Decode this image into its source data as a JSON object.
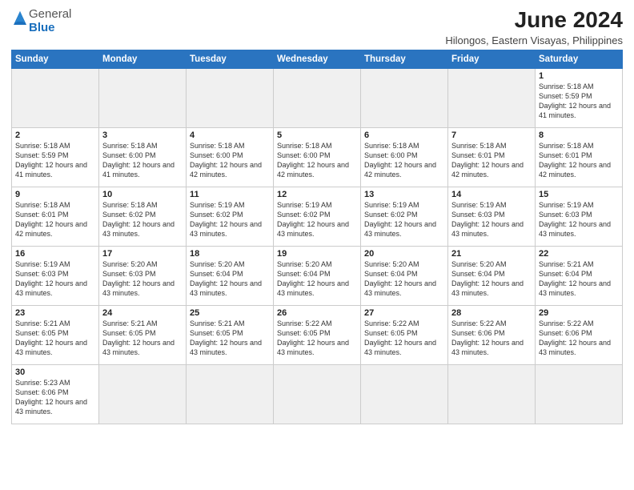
{
  "header": {
    "logo_general": "General",
    "logo_blue": "Blue",
    "title": "June 2024",
    "subtitle": "Hilongos, Eastern Visayas, Philippines"
  },
  "weekdays": [
    "Sunday",
    "Monday",
    "Tuesday",
    "Wednesday",
    "Thursday",
    "Friday",
    "Saturday"
  ],
  "weeks": [
    [
      {
        "day": "",
        "info": "",
        "empty": true
      },
      {
        "day": "",
        "info": "",
        "empty": true
      },
      {
        "day": "",
        "info": "",
        "empty": true
      },
      {
        "day": "",
        "info": "",
        "empty": true
      },
      {
        "day": "",
        "info": "",
        "empty": true
      },
      {
        "day": "",
        "info": "",
        "empty": true
      },
      {
        "day": "1",
        "info": "Sunrise: 5:18 AM\nSunset: 5:59 PM\nDaylight: 12 hours and 41 minutes.",
        "empty": false
      }
    ],
    [
      {
        "day": "2",
        "info": "Sunrise: 5:18 AM\nSunset: 5:59 PM\nDaylight: 12 hours and 41 minutes.",
        "empty": false
      },
      {
        "day": "3",
        "info": "Sunrise: 5:18 AM\nSunset: 6:00 PM\nDaylight: 12 hours and 41 minutes.",
        "empty": false
      },
      {
        "day": "4",
        "info": "Sunrise: 5:18 AM\nSunset: 6:00 PM\nDaylight: 12 hours and 42 minutes.",
        "empty": false
      },
      {
        "day": "5",
        "info": "Sunrise: 5:18 AM\nSunset: 6:00 PM\nDaylight: 12 hours and 42 minutes.",
        "empty": false
      },
      {
        "day": "6",
        "info": "Sunrise: 5:18 AM\nSunset: 6:00 PM\nDaylight: 12 hours and 42 minutes.",
        "empty": false
      },
      {
        "day": "7",
        "info": "Sunrise: 5:18 AM\nSunset: 6:01 PM\nDaylight: 12 hours and 42 minutes.",
        "empty": false
      },
      {
        "day": "8",
        "info": "Sunrise: 5:18 AM\nSunset: 6:01 PM\nDaylight: 12 hours and 42 minutes.",
        "empty": false
      }
    ],
    [
      {
        "day": "9",
        "info": "Sunrise: 5:18 AM\nSunset: 6:01 PM\nDaylight: 12 hours and 42 minutes.",
        "empty": false
      },
      {
        "day": "10",
        "info": "Sunrise: 5:18 AM\nSunset: 6:02 PM\nDaylight: 12 hours and 43 minutes.",
        "empty": false
      },
      {
        "day": "11",
        "info": "Sunrise: 5:19 AM\nSunset: 6:02 PM\nDaylight: 12 hours and 43 minutes.",
        "empty": false
      },
      {
        "day": "12",
        "info": "Sunrise: 5:19 AM\nSunset: 6:02 PM\nDaylight: 12 hours and 43 minutes.",
        "empty": false
      },
      {
        "day": "13",
        "info": "Sunrise: 5:19 AM\nSunset: 6:02 PM\nDaylight: 12 hours and 43 minutes.",
        "empty": false
      },
      {
        "day": "14",
        "info": "Sunrise: 5:19 AM\nSunset: 6:03 PM\nDaylight: 12 hours and 43 minutes.",
        "empty": false
      },
      {
        "day": "15",
        "info": "Sunrise: 5:19 AM\nSunset: 6:03 PM\nDaylight: 12 hours and 43 minutes.",
        "empty": false
      }
    ],
    [
      {
        "day": "16",
        "info": "Sunrise: 5:19 AM\nSunset: 6:03 PM\nDaylight: 12 hours and 43 minutes.",
        "empty": false
      },
      {
        "day": "17",
        "info": "Sunrise: 5:20 AM\nSunset: 6:03 PM\nDaylight: 12 hours and 43 minutes.",
        "empty": false
      },
      {
        "day": "18",
        "info": "Sunrise: 5:20 AM\nSunset: 6:04 PM\nDaylight: 12 hours and 43 minutes.",
        "empty": false
      },
      {
        "day": "19",
        "info": "Sunrise: 5:20 AM\nSunset: 6:04 PM\nDaylight: 12 hours and 43 minutes.",
        "empty": false
      },
      {
        "day": "20",
        "info": "Sunrise: 5:20 AM\nSunset: 6:04 PM\nDaylight: 12 hours and 43 minutes.",
        "empty": false
      },
      {
        "day": "21",
        "info": "Sunrise: 5:20 AM\nSunset: 6:04 PM\nDaylight: 12 hours and 43 minutes.",
        "empty": false
      },
      {
        "day": "22",
        "info": "Sunrise: 5:21 AM\nSunset: 6:04 PM\nDaylight: 12 hours and 43 minutes.",
        "empty": false
      }
    ],
    [
      {
        "day": "23",
        "info": "Sunrise: 5:21 AM\nSunset: 6:05 PM\nDaylight: 12 hours and 43 minutes.",
        "empty": false
      },
      {
        "day": "24",
        "info": "Sunrise: 5:21 AM\nSunset: 6:05 PM\nDaylight: 12 hours and 43 minutes.",
        "empty": false
      },
      {
        "day": "25",
        "info": "Sunrise: 5:21 AM\nSunset: 6:05 PM\nDaylight: 12 hours and 43 minutes.",
        "empty": false
      },
      {
        "day": "26",
        "info": "Sunrise: 5:22 AM\nSunset: 6:05 PM\nDaylight: 12 hours and 43 minutes.",
        "empty": false
      },
      {
        "day": "27",
        "info": "Sunrise: 5:22 AM\nSunset: 6:05 PM\nDaylight: 12 hours and 43 minutes.",
        "empty": false
      },
      {
        "day": "28",
        "info": "Sunrise: 5:22 AM\nSunset: 6:06 PM\nDaylight: 12 hours and 43 minutes.",
        "empty": false
      },
      {
        "day": "29",
        "info": "Sunrise: 5:22 AM\nSunset: 6:06 PM\nDaylight: 12 hours and 43 minutes.",
        "empty": false
      }
    ],
    [
      {
        "day": "30",
        "info": "Sunrise: 5:23 AM\nSunset: 6:06 PM\nDaylight: 12 hours and 43 minutes.",
        "empty": false
      },
      {
        "day": "",
        "info": "",
        "empty": true
      },
      {
        "day": "",
        "info": "",
        "empty": true
      },
      {
        "day": "",
        "info": "",
        "empty": true
      },
      {
        "day": "",
        "info": "",
        "empty": true
      },
      {
        "day": "",
        "info": "",
        "empty": true
      },
      {
        "day": "",
        "info": "",
        "empty": true
      }
    ]
  ]
}
